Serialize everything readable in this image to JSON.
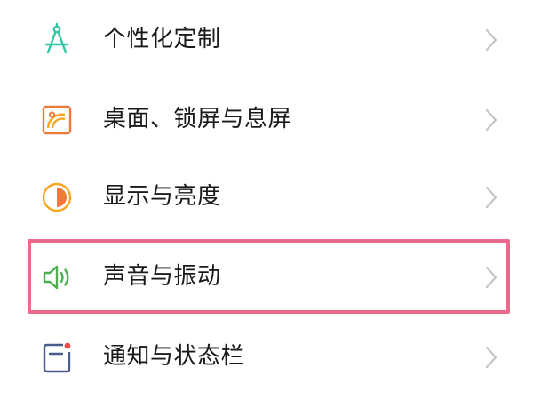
{
  "settings": {
    "items": [
      {
        "label": "个性化定制",
        "icon": "compass-icon"
      },
      {
        "label": "桌面、锁屏与息屏",
        "icon": "wallpaper-icon"
      },
      {
        "label": "显示与亮度",
        "icon": "brightness-icon"
      },
      {
        "label": "声音与振动",
        "icon": "speaker-icon"
      },
      {
        "label": "通知与状态栏",
        "icon": "notification-icon"
      }
    ],
    "highlighted_item": "声音与振动"
  },
  "colors": {
    "highlight": "#e96b8c",
    "compass_icon": "#33c6a6",
    "wallpaper_icon": "#f07a3c",
    "brightness_icon": "#f5a623",
    "speaker_icon": "#4caf50",
    "notification_icon": "#4a5d8a",
    "notification_dot": "#f04a4a",
    "chevron": "#c4c4c4"
  }
}
